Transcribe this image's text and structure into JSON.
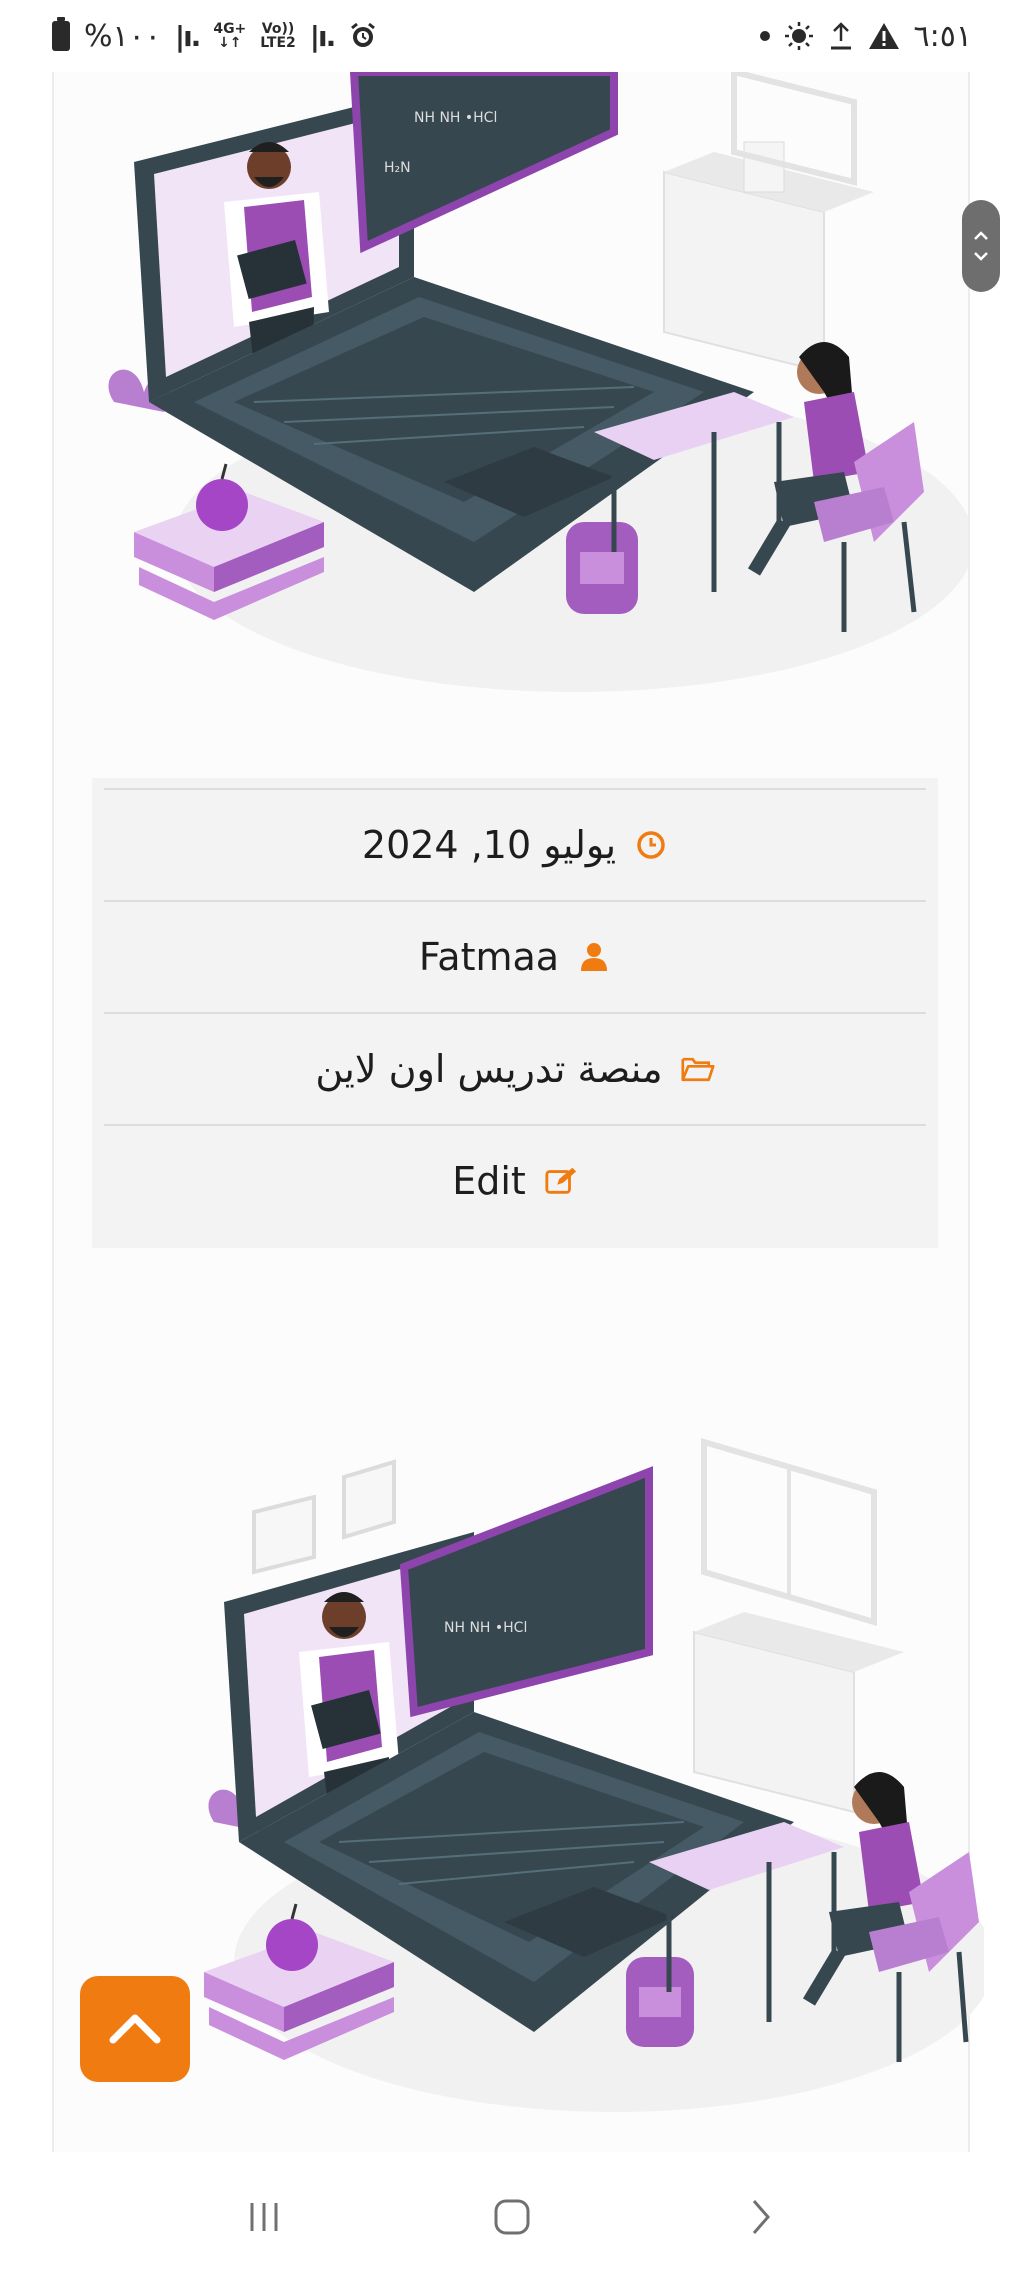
{
  "status_bar": {
    "battery_text": "%١٠٠",
    "network_top": "4G+",
    "network_bottom": "↓↑",
    "volte_top": "Vo))",
    "volte_bottom": "LTE2",
    "time": "٦:٥١"
  },
  "post_meta": {
    "date": "يوليو 10, 2024",
    "author": "Fatmaa",
    "category": "منصة تدريس اون لاين",
    "edit_label": "Edit"
  },
  "colors": {
    "accent": "#f07b10",
    "illustration_purple": "#9b4db4",
    "illustration_dark": "#37474f"
  },
  "icons": {
    "date": "clock-icon",
    "author": "user-icon",
    "category": "folder-open-icon",
    "edit": "edit-icon",
    "back_to_top": "chevron-up-icon"
  }
}
